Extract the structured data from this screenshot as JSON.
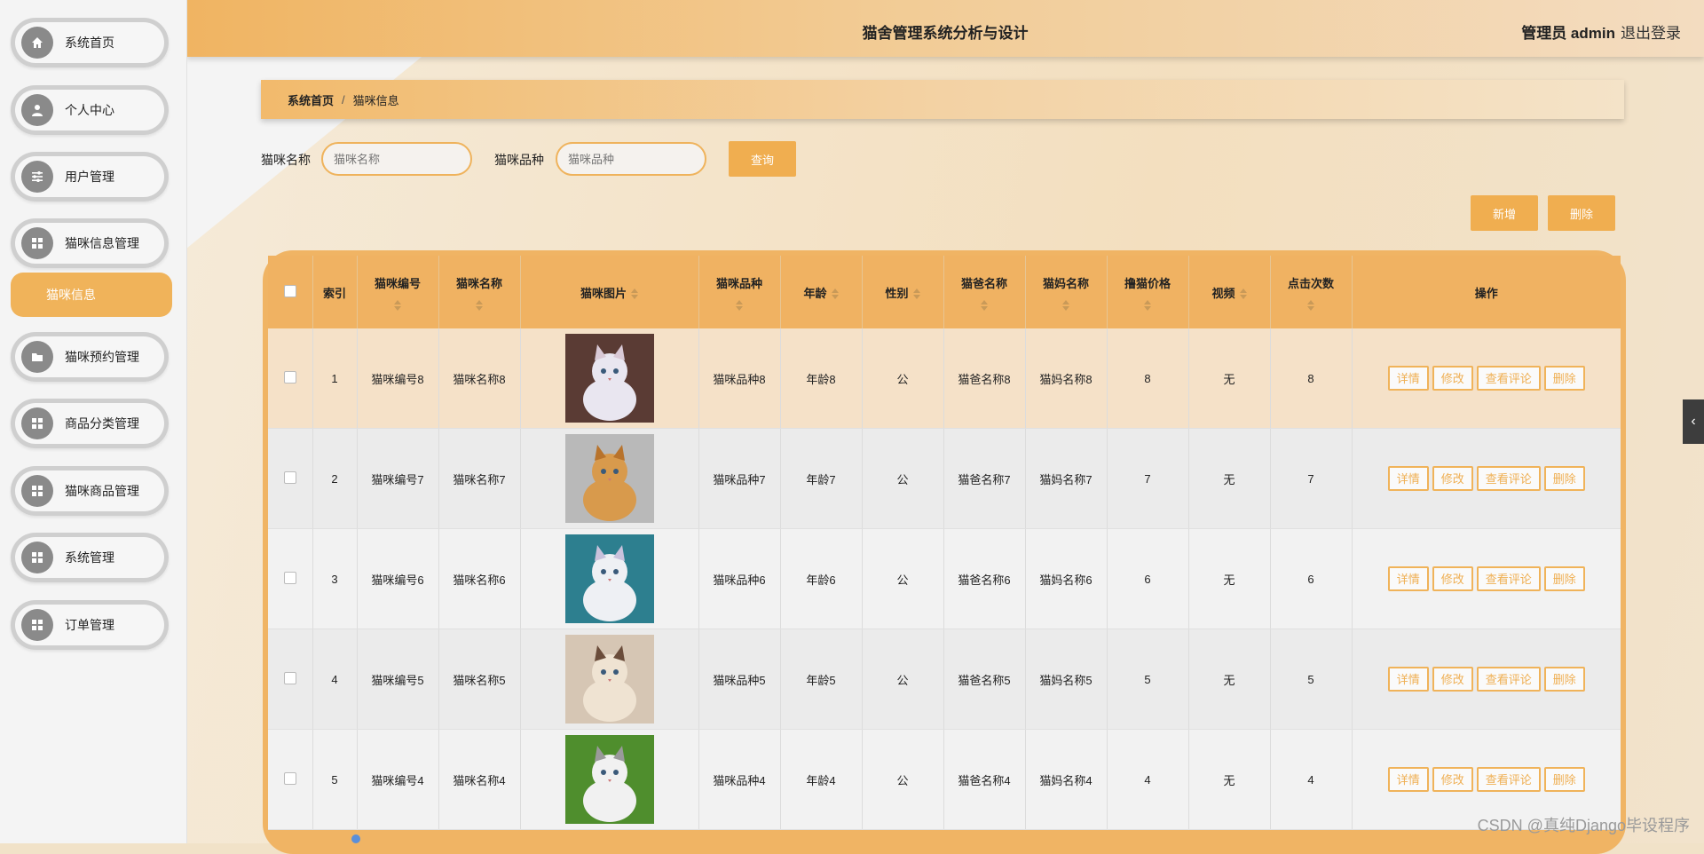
{
  "header": {
    "title": "猫舍管理系统分析与设计",
    "admin": "管理员 admin",
    "logout": "退出登录"
  },
  "sidebar": {
    "items": [
      {
        "label": "系统首页",
        "icon": "home-icon"
      },
      {
        "label": "个人中心",
        "icon": "user-icon"
      },
      {
        "label": "用户管理",
        "icon": "sliders-icon"
      },
      {
        "label": "猫咪信息管理",
        "icon": "grid-icon"
      },
      {
        "label": "猫咪预约管理",
        "icon": "folder-icon"
      },
      {
        "label": "商品分类管理",
        "icon": "grid-icon"
      },
      {
        "label": "猫咪商品管理",
        "icon": "grid-icon"
      },
      {
        "label": "系统管理",
        "icon": "grid-icon"
      },
      {
        "label": "订单管理",
        "icon": "grid-icon"
      }
    ],
    "active_sub": "猫咪信息"
  },
  "breadcrumb": {
    "home": "系统首页",
    "sep": "/",
    "current": "猫咪信息"
  },
  "search": {
    "name_label": "猫咪名称",
    "name_placeholder": "猫咪名称",
    "breed_label": "猫咪品种",
    "breed_placeholder": "猫咪品种",
    "query_button": "查询"
  },
  "toolbar": {
    "add_button": "新增",
    "delete_button": "删除"
  },
  "table": {
    "columns": [
      "索引",
      "猫咪编号",
      "猫咪名称",
      "猫咪图片",
      "猫咪品种",
      "年龄",
      "性别",
      "猫爸名称",
      "猫妈名称",
      "撸猫价格",
      "视频",
      "点击次数",
      "操作"
    ],
    "actions": [
      "详情",
      "修改",
      "查看评论",
      "删除"
    ],
    "rows": [
      {
        "index": "1",
        "code": "猫咪编号8",
        "name": "猫咪名称8",
        "breed": "猫咪品种8",
        "age": "年龄8",
        "sex": "公",
        "father": "猫爸名称8",
        "mother": "猫妈名称8",
        "price": "8",
        "video": "无",
        "clicks": "8"
      },
      {
        "index": "2",
        "code": "猫咪编号7",
        "name": "猫咪名称7",
        "breed": "猫咪品种7",
        "age": "年龄7",
        "sex": "公",
        "father": "猫爸名称7",
        "mother": "猫妈名称7",
        "price": "7",
        "video": "无",
        "clicks": "7"
      },
      {
        "index": "3",
        "code": "猫咪编号6",
        "name": "猫咪名称6",
        "breed": "猫咪品种6",
        "age": "年龄6",
        "sex": "公",
        "father": "猫爸名称6",
        "mother": "猫妈名称6",
        "price": "6",
        "video": "无",
        "clicks": "6"
      },
      {
        "index": "4",
        "code": "猫咪编号5",
        "name": "猫咪名称5",
        "breed": "猫咪品种5",
        "age": "年龄5",
        "sex": "公",
        "father": "猫爸名称5",
        "mother": "猫妈名称5",
        "price": "5",
        "video": "无",
        "clicks": "5"
      },
      {
        "index": "5",
        "code": "猫咪编号4",
        "name": "猫咪名称4",
        "breed": "猫咪品种4",
        "age": "年龄4",
        "sex": "公",
        "father": "猫爸名称4",
        "mother": "猫妈名称4",
        "price": "4",
        "video": "无",
        "clicks": "4"
      }
    ]
  },
  "watermark": "CSDN @真纯Django毕设程序",
  "colors": {
    "accent": "#f0b35a",
    "header_start": "#f0b462"
  }
}
